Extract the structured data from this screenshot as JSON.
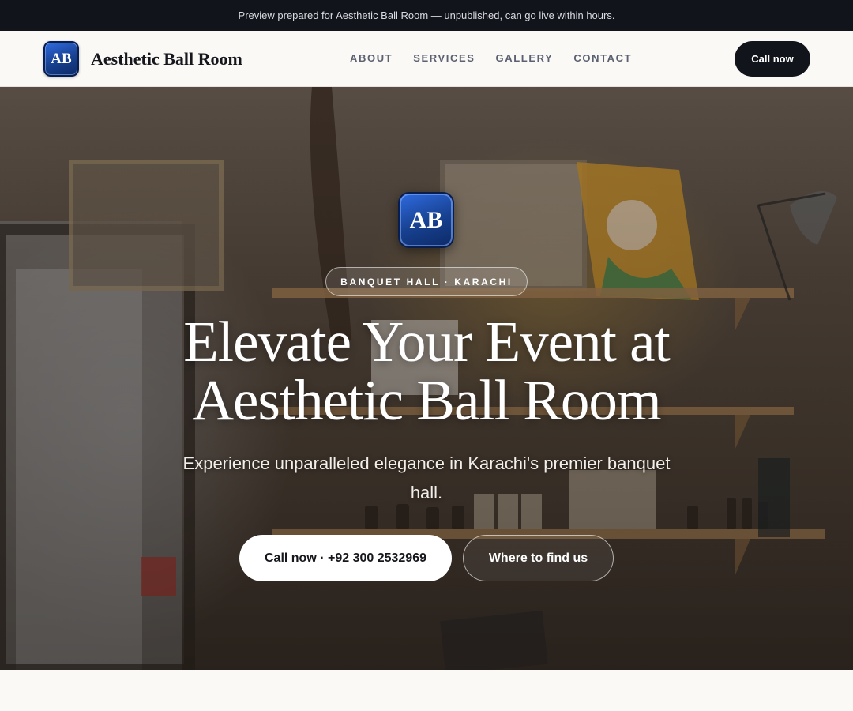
{
  "announcement": {
    "text": "Preview prepared for Aesthetic Ball Room — unpublished, can go live within hours."
  },
  "brand": {
    "initials": "AB",
    "name": "Aesthetic Ball Room"
  },
  "nav": {
    "links": [
      {
        "label": "ABOUT"
      },
      {
        "label": "SERVICES"
      },
      {
        "label": "GALLERY"
      },
      {
        "label": "CONTACT"
      }
    ],
    "cta_label": "Call now"
  },
  "hero": {
    "logo_initials": "AB",
    "tag": "BANQUET HALL · KARACHI",
    "title_line1": "Elevate Your Event at",
    "title_line2": "Aesthetic Ball Room",
    "subtitle": "Experience unparalleled elegance in Karachi's premier banquet hall.",
    "primary_cta": "Call now · +92 300 2532969",
    "secondary_cta": "Where to find us"
  },
  "colors": {
    "topbar_bg": "#12141b",
    "page_bg": "#faf9f6",
    "dark_button": "#12141b",
    "logo_blue": "#17408f"
  }
}
